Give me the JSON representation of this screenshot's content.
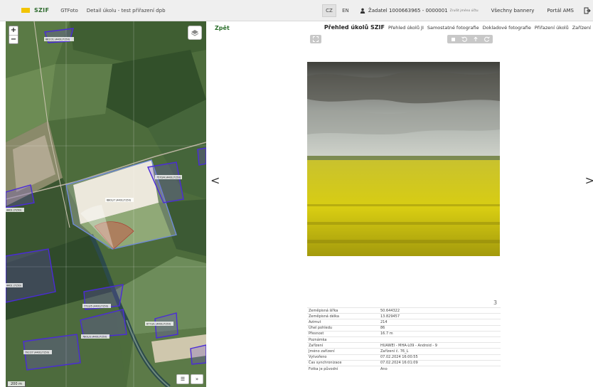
{
  "header": {
    "logo_text": "SZIF",
    "nav": [
      "GTFoto",
      "Detail úkolu - test přiřazení dpb"
    ],
    "languages": [
      {
        "code": "CZ",
        "active": true
      },
      {
        "code": "EN",
        "active": false
      }
    ],
    "user": {
      "label": "Žadatel 1000663965 - 0000001",
      "note": "Zrušit jméno účtu"
    },
    "links": [
      "Všechny bannery",
      "Portál AMS"
    ]
  },
  "map": {
    "zoom_in": "+",
    "zoom_out": "−",
    "scale": "200 m",
    "parcel_labels": [
      "6617/1 (4401/7150)",
      "7570/4 (4401/7150)",
      "6801/7 (4401/7150)",
      "4401 (7150)",
      "4401 (7150)",
      "7712/5 (4401/7150)",
      "6773/1 (4401/7150)",
      "7801/3 (4401/7150)",
      "7917/7 (4401/7150)"
    ],
    "list_button": "☰",
    "next_button": "»"
  },
  "panel": {
    "back": "Zpět",
    "tabs": [
      {
        "label": "Přehled úkolů SZIF",
        "active": true
      },
      {
        "label": "Přehled úkolů JI",
        "active": false
      },
      {
        "label": "Samostatné fotografie",
        "active": false
      },
      {
        "label": "Dokladové fotografie",
        "active": false
      },
      {
        "label": "Přiřazení úkolů",
        "active": false
      },
      {
        "label": "Zařízení",
        "active": false
      }
    ],
    "prev_arrow": "<",
    "next_arrow": ">",
    "photo_number": "3",
    "info_rows": [
      {
        "key": "Zeměpisná šířka",
        "value": "50.644322"
      },
      {
        "key": "Zeměpisná délka",
        "value": "13.829457"
      },
      {
        "key": "Azimut",
        "value": "214"
      },
      {
        "key": "Úhel pohledu",
        "value": "86"
      },
      {
        "key": "Přesnost",
        "value": "16.7 m"
      },
      {
        "key": "Poznámka",
        "value": ""
      },
      {
        "key": "Zařízení",
        "value": "HUAWEI - MHA-L09 - Android - 9"
      },
      {
        "key": "Jméno zařízení",
        "value": "Zařízení č. 76_L"
      },
      {
        "key": "Vytvořeno",
        "value": "07.02.2024 16:00:55"
      },
      {
        "key": "Čas synchronizace",
        "value": "07.02.2024 16:01:09"
      },
      {
        "key": "Fotka je původní",
        "value": "Ano"
      }
    ]
  },
  "colors": {
    "brand_yellow": "#f2c400",
    "brand_green": "#2a6e2a",
    "parcel_outline": "#5a3ed8"
  }
}
